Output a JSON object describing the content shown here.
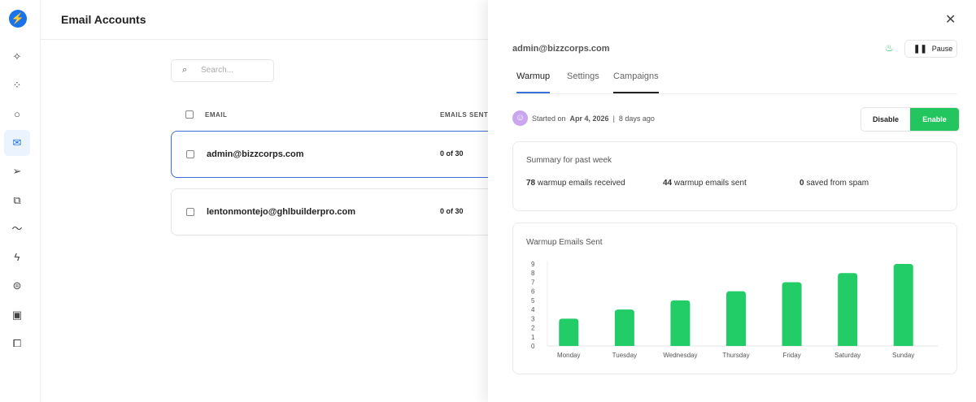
{
  "sidebar": {
    "items": [
      "sparkle-icon",
      "cluster-icon",
      "search-icon",
      "mail-icon",
      "send-icon",
      "copy-icon",
      "trend-icon",
      "bolt-icon",
      "ufo-icon",
      "inbox-icon",
      "shapes-icon"
    ],
    "active": "mail-icon"
  },
  "header": {
    "title": "Email Accounts"
  },
  "search": {
    "placeholder": "Search..."
  },
  "table": {
    "headers": [
      "EMAIL",
      "EMAILS SENT"
    ],
    "rows": [
      {
        "email": "admin@bizzcorps.com",
        "sent": "0 of 30"
      },
      {
        "email": "lentonmontejo@ghlbuilderpro.com",
        "sent": "0 of 30"
      }
    ]
  },
  "drawer": {
    "account": "admin@bizzcorps.com",
    "pause_label": "Pause",
    "tabs": [
      "Warmup",
      "Settings",
      "Campaigns"
    ],
    "started_label": "Started on",
    "started_date": "Apr 4, 2026",
    "started_ago": "8 days ago",
    "sep": "|",
    "disable_label": "Disable",
    "enable_label": "Enable",
    "summary": {
      "title": "Summary for past week",
      "stats": [
        {
          "num": "78",
          "label": "warmup emails received"
        },
        {
          "num": "44",
          "label": "warmup emails sent"
        },
        {
          "num": "0",
          "label": "saved from spam"
        }
      ]
    }
  },
  "colors": {
    "accent": "#3b6fd6",
    "green": "#22c55e"
  },
  "chart_data": {
    "type": "bar",
    "title": "Warmup Emails Sent",
    "categories": [
      "Monday",
      "Tuesday",
      "Wednesday",
      "Thursday",
      "Friday",
      "Saturday",
      "Sunday"
    ],
    "values": [
      3,
      4,
      5,
      6,
      7,
      8,
      9
    ],
    "ylim": [
      0,
      9
    ],
    "yticks": [
      0,
      1,
      2,
      3,
      4,
      5,
      6,
      7,
      8,
      9
    ],
    "xlabel": "",
    "ylabel": ""
  }
}
